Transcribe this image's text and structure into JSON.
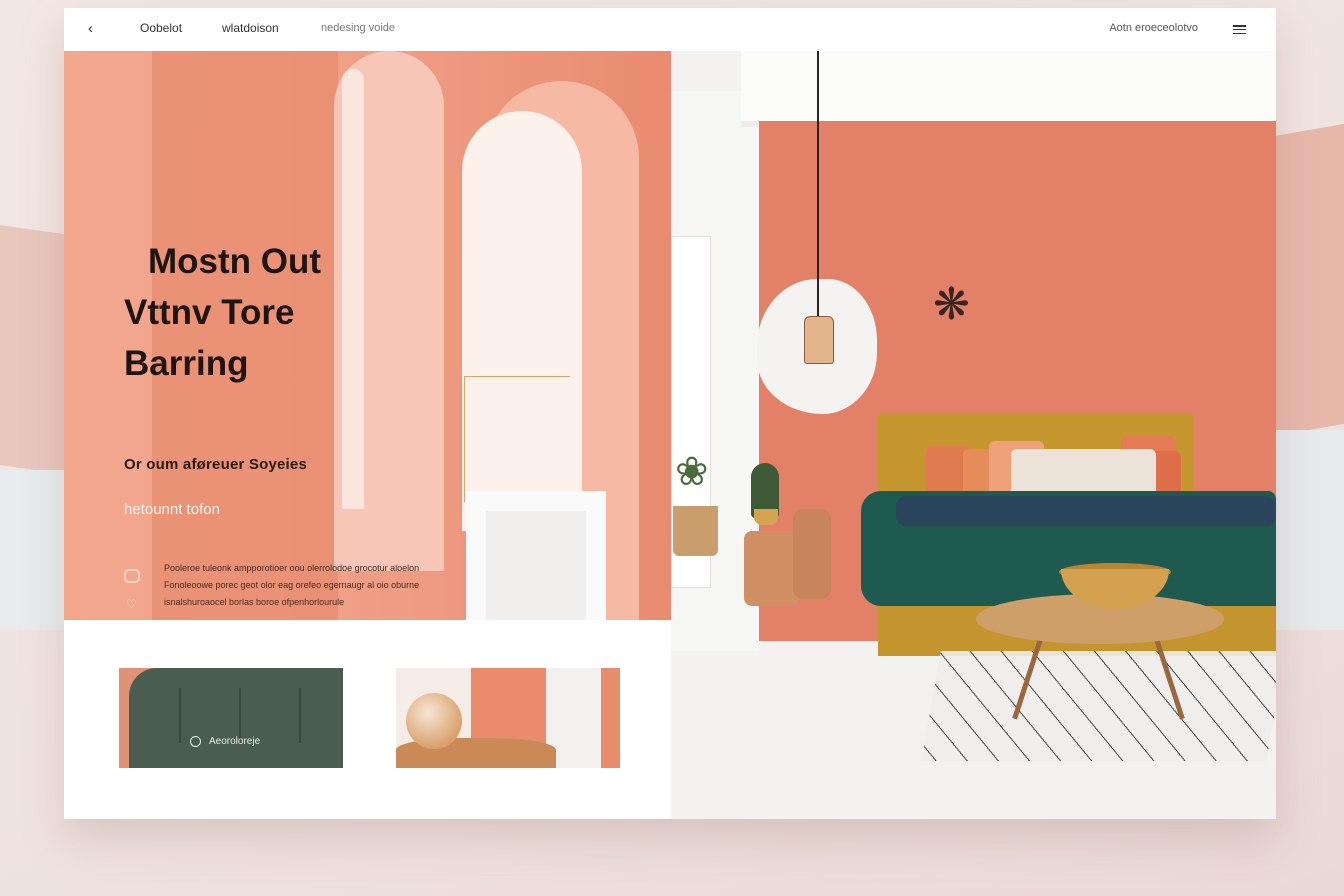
{
  "topbar": {
    "back_icon": "chevron-left-icon",
    "nav": [
      "Oobelot",
      "wlatdoison",
      "nedesing voide"
    ],
    "right_link": "Aotn eroeceolotvo",
    "menu_icon": "hamburger-menu-icon"
  },
  "hero": {
    "title_lines": [
      "Mostn Out",
      "Vttnv Tore",
      "Barring"
    ],
    "subtitle": "Or oum aføreuer Soyeies",
    "link": "hetounnt tofon",
    "features": [
      "Pooleroe tuleonk ampporotioer oou olerrolodoe grocotur aloelon",
      "Fonoleoowe porec geot olor eag orefeo egernaugr al oio oburne",
      "isnalshuroaocel borlas boroe ofpenhorlourule"
    ],
    "feature_icons": [
      "bubble-icon",
      "heart-icon"
    ]
  },
  "thumbnails": [
    {
      "label": "Aeoroloreje"
    },
    {
      "label": ""
    }
  ],
  "colors": {
    "accent": "#e98e72",
    "wall": "#e38068",
    "teal": "#1f5a50",
    "mustard": "#c7972f"
  }
}
